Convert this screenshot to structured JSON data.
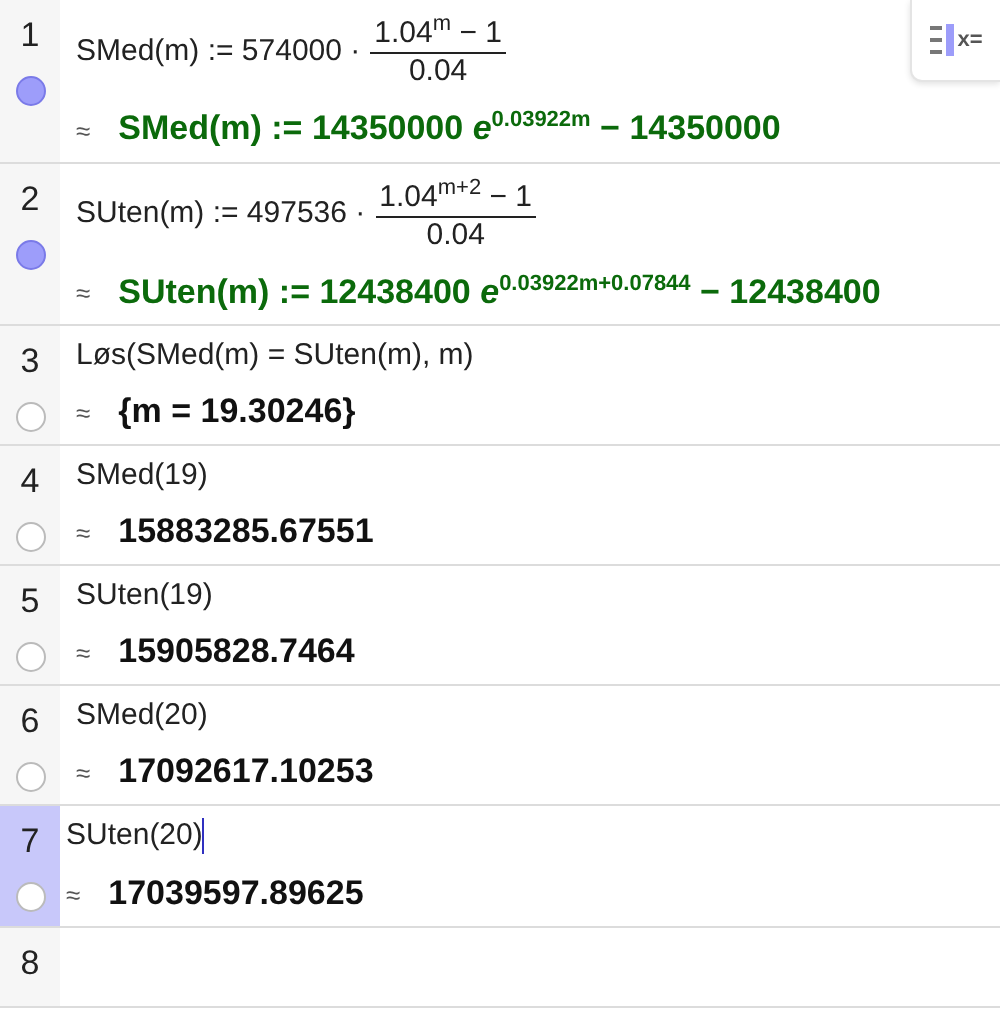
{
  "style_button": {
    "label": "x="
  },
  "rows": [
    {
      "number": "1",
      "visible": true,
      "selected": false,
      "editing": false,
      "input": {
        "kind": "fraction",
        "lhs": "SMed(m) := 574000 ·",
        "numerator": "1.04$^{m}$ − 1",
        "denominator": "0.04"
      },
      "output": {
        "symbol": "≈",
        "kind": "definition",
        "text": "SMed(m) := 14350000 *e*$^{0.03922m}$ − 14350000"
      }
    },
    {
      "number": "2",
      "visible": true,
      "selected": false,
      "editing": false,
      "input": {
        "kind": "fraction",
        "lhs": "SUten(m) := 497536 ·",
        "numerator": "1.04$^{m+2}$ − 1",
        "denominator": "0.04"
      },
      "output": {
        "symbol": "≈",
        "kind": "definition",
        "text": "SUten(m) := 12438400 *e*$^{0.03922m+0.07844}$ − 12438400"
      }
    },
    {
      "number": "3",
      "visible": false,
      "selected": false,
      "editing": false,
      "input": {
        "kind": "text",
        "text": "Løs(SMed(m) = SUten(m), m)"
      },
      "output": {
        "symbol": "≈",
        "kind": "value",
        "text": "{m = 19.30246}"
      }
    },
    {
      "number": "4",
      "visible": false,
      "selected": false,
      "editing": false,
      "input": {
        "kind": "text",
        "text": "SMed(19)"
      },
      "output": {
        "symbol": "≈",
        "kind": "value",
        "text": "15883285.67551"
      }
    },
    {
      "number": "5",
      "visible": false,
      "selected": false,
      "editing": false,
      "input": {
        "kind": "text",
        "text": "SUten(19)"
      },
      "output": {
        "symbol": "≈",
        "kind": "value",
        "text": "15905828.7464"
      }
    },
    {
      "number": "6",
      "visible": false,
      "selected": false,
      "editing": false,
      "input": {
        "kind": "text",
        "text": "SMed(20)"
      },
      "output": {
        "symbol": "≈",
        "kind": "value",
        "text": "17092617.10253"
      }
    },
    {
      "number": "7",
      "visible": false,
      "selected": true,
      "editing": true,
      "input": {
        "kind": "text",
        "text": "SUten(20)"
      },
      "output": {
        "symbol": "≈",
        "kind": "value",
        "text": "17039597.89625"
      }
    },
    {
      "number": "8",
      "selected": false
    }
  ]
}
